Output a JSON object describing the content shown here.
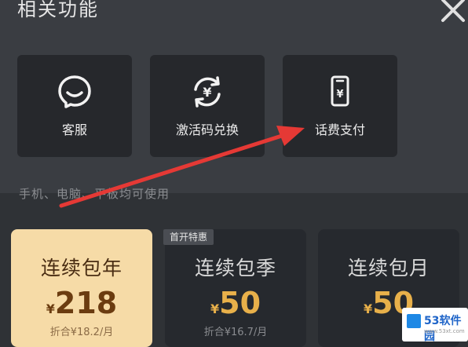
{
  "sheet": {
    "title": "相关功能",
    "cards": [
      {
        "label": "客服",
        "icon": "chat-bubble-icon"
      },
      {
        "label": "激活码兑换",
        "icon": "yuan-exchange-icon"
      },
      {
        "label": "话费支付",
        "icon": "phone-yuan-icon"
      }
    ]
  },
  "membership": {
    "note": "手机、电脑、平板均可使用",
    "badge": "首开特惠",
    "plans": [
      {
        "name": "连续包年",
        "currency": "¥",
        "price": "218",
        "sub": "折合¥18.2/月",
        "active": true
      },
      {
        "name": "连续包季",
        "currency": "¥",
        "price": "50",
        "sub": "折合¥16.7/月",
        "active": false
      },
      {
        "name": "连续包月",
        "currency": "¥",
        "price": "50",
        "sub": "",
        "active": false
      }
    ]
  },
  "watermark": {
    "text": "53软件园",
    "url": "www.53xt.com"
  },
  "colors": {
    "annotation_arrow": "#e53935",
    "active_plan": "#f6dba7",
    "price_gold": "#e8b04a"
  }
}
